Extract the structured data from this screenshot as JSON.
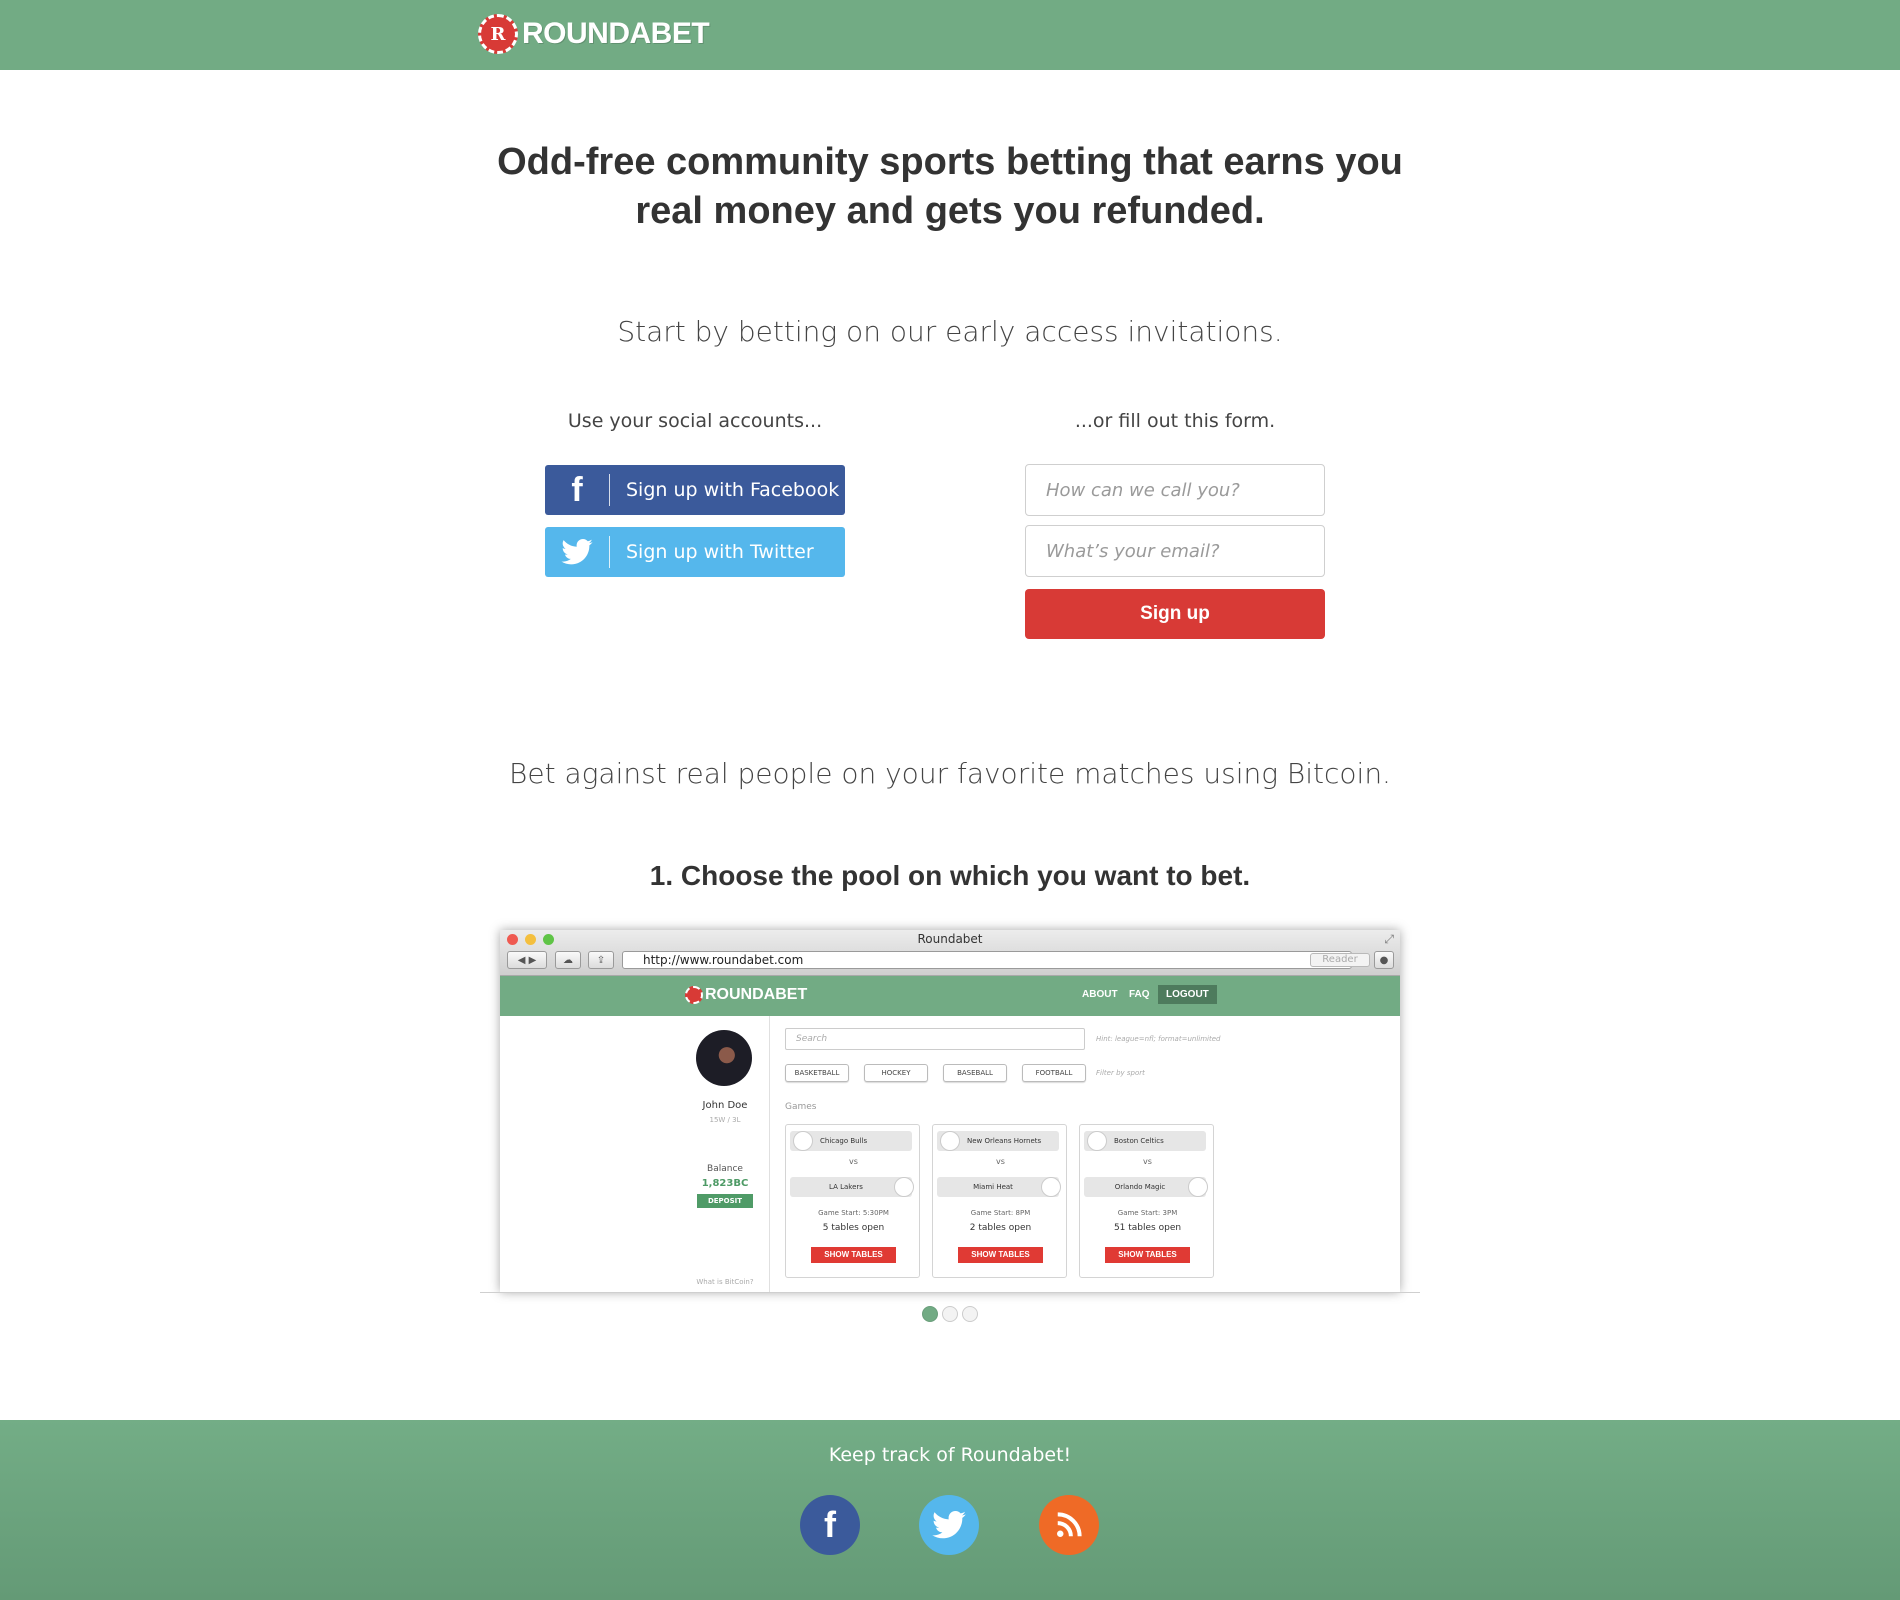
{
  "brand": {
    "name": "ROUNDABET",
    "chip_letter": "R"
  },
  "hero": {
    "headline_line1": "Odd-free community sports betting that earns you",
    "headline_line2": "real money and gets you refunded.",
    "subhead": "Start by betting on our early access invitations."
  },
  "signup": {
    "social_label": "Use your social accounts...",
    "form_label": "...or fill out this form.",
    "facebook_button": "Sign up with Facebook",
    "twitter_button": "Sign up with Twitter",
    "name_placeholder": "How can we call you?",
    "email_placeholder": "What’s your email?",
    "submit_label": "Sign up"
  },
  "features": {
    "tagline": "Bet against real people on your favorite matches using Bitcoin.",
    "step_title": "1. Choose the pool on which you want to bet."
  },
  "screenshot": {
    "window_title": "Roundabet",
    "url": "http://www.roundabet.com",
    "reader": "Reader",
    "nav": {
      "about": "ABOUT",
      "faq": "FAQ",
      "logout": "LOGOUT"
    },
    "profile": {
      "name": "John Doe",
      "record": "15W / 3L",
      "balance_label": "Balance",
      "balance": "1,823BC",
      "deposit": "DEPOSIT",
      "bitcoin_link": "What is BitCoin?"
    },
    "search_placeholder": "Search",
    "search_hint": "Hint: league=nfl; format=unlimited",
    "filters": [
      "BASKETBALL",
      "HOCKEY",
      "BASEBALL",
      "FOOTBALL"
    ],
    "filter_hint": "Filter by sport",
    "games_label": "Games",
    "games": [
      {
        "home": "Chicago Bulls",
        "away": "LA Lakers",
        "vs": "vs",
        "start": "Game Start: 5:30PM",
        "tables": "5 tables open",
        "button": "SHOW TABLES"
      },
      {
        "home": "New Orleans Hornets",
        "away": "Miami Heat",
        "vs": "vs",
        "start": "Game Start: 8PM",
        "tables": "2 tables open",
        "button": "SHOW TABLES"
      },
      {
        "home": "Boston Celtics",
        "away": "Orlando Magic",
        "vs": "vs",
        "start": "Game Start: 3PM",
        "tables": "51 tables open",
        "button": "SHOW TABLES"
      }
    ]
  },
  "carousel": {
    "count": 3,
    "active": 1
  },
  "footer": {
    "text": "Keep track of Roundabet!",
    "icons": [
      "facebook-icon",
      "twitter-icon",
      "rss-icon"
    ]
  },
  "colors": {
    "brand_green": "#72ab84",
    "accent_red": "#d83a36",
    "facebook_blue": "#3b5a9b",
    "twitter_blue": "#55b7ec",
    "rss_orange": "#ef6a26"
  }
}
